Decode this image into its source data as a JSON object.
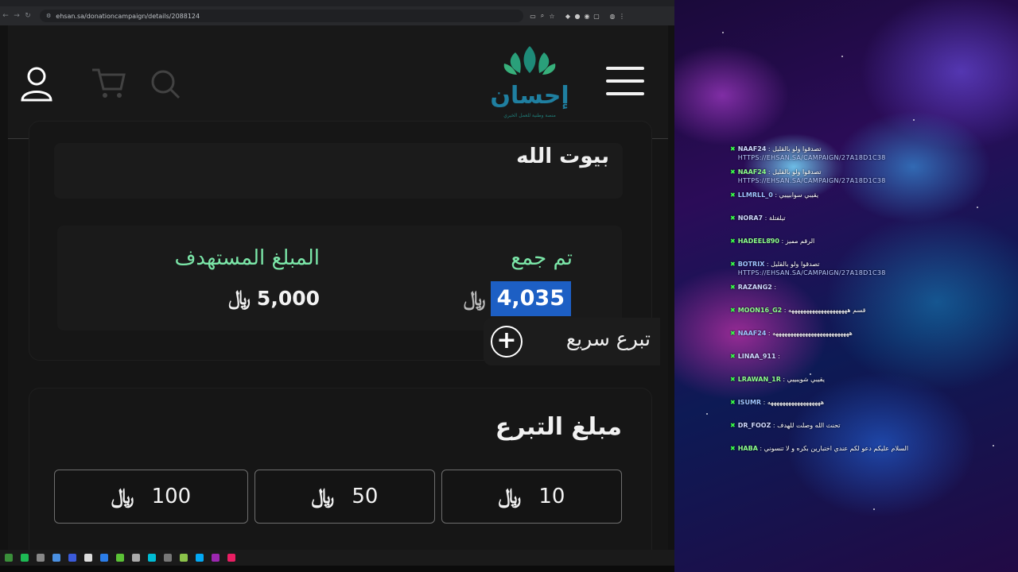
{
  "browser": {
    "url": "ehsan.sa/donationcampaign/details/2088124",
    "tabs": []
  },
  "site": {
    "logo_text": "إحسان",
    "logo_tagline": "منصة وطنية للعمل الخيري"
  },
  "campaign": {
    "title": "بيوت الله",
    "raised_label": "تم جمع",
    "raised_value": "4,035",
    "target_label": "المبلغ المستهدف",
    "target_value": "5,000",
    "currency_symbol": "﷼"
  },
  "quick_donate": {
    "label": "تبرع سريع"
  },
  "donation": {
    "title": "مبلغ التبرع",
    "amounts": [
      "10",
      "50",
      "100"
    ]
  },
  "chat": {
    "messages": [
      {
        "user": "NAAF24",
        "text": "تصدقوا ولو بالقليل",
        "link": "HTTPS://EHSAN.SA/CAMPAIGN/27A18D1C38"
      },
      {
        "user": "NAAF24",
        "text": "تصدقوا ولو بالقليل",
        "link": "HTTPS://EHSAN.SA/CAMPAIGN/27A18D1C38"
      },
      {
        "user": "LLMRLL_0",
        "text": "يقيبي سوابيييي",
        "link": ""
      },
      {
        "user": "NORA7",
        "text": "تيلفتلة",
        "link": ""
      },
      {
        "user": "HADEEL890",
        "text": "الرقم مميز",
        "link": ""
      },
      {
        "user": "BOTRIX",
        "text": "تصدقوا ولو بالقليل",
        "link": "HTTPS://EHSAN.SA/CAMPAIGN/27A18D1C38"
      },
      {
        "user": "RAZANG2",
        "text": "",
        "link": ""
      },
      {
        "user": "MOON16_G2",
        "text": "قسم ههههههههههههههههههههه",
        "link": ""
      },
      {
        "user": "NAAF24",
        "text": "ههههههههههههههههههههههههههه",
        "link": ""
      },
      {
        "user": "LINAA_911",
        "text": "",
        "link": ""
      },
      {
        "user": "LRAWAN_1R",
        "text": "يقيبي شويبييي",
        "link": ""
      },
      {
        "user": "ISUMR",
        "text": "ههههههههههههههههههه",
        "link": ""
      },
      {
        "user": "DR_FOOZ",
        "text": "تحنث الله وصلت للهدف",
        "link": ""
      },
      {
        "user": "HABA",
        "text": "السلام عليكم دعو لكم عندي اختبارين بكره و لا تنسوني",
        "link": ""
      }
    ]
  },
  "colors": {
    "accent_green": "#7be6a8",
    "highlight_blue": "#1d5fc4",
    "logo_teal": "#1f7fa0",
    "page_bg": "#151515"
  }
}
